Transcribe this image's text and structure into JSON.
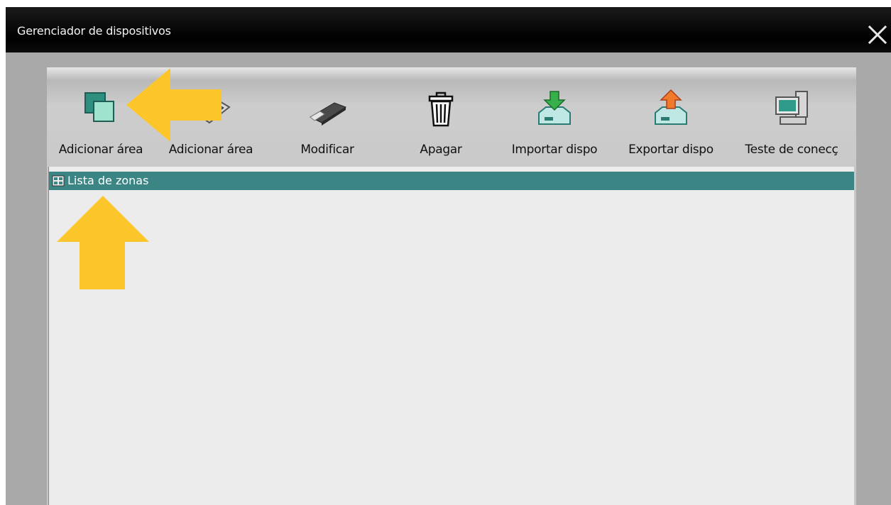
{
  "window": {
    "title": "Gerenciador de dispositivos",
    "close_icon": "close-icon"
  },
  "toolbar": {
    "items": [
      {
        "label": "Adicionar área",
        "icon": "add-area-icon"
      },
      {
        "label": "Adicionar área",
        "icon": "add-device-icon"
      },
      {
        "label": "Modificar",
        "icon": "modify-icon"
      },
      {
        "label": "Apagar",
        "icon": "trash-icon"
      },
      {
        "label": "Importar dispo",
        "icon": "import-icon"
      },
      {
        "label": "Exportar dispo",
        "icon": "export-icon"
      },
      {
        "label": "Teste de conecç",
        "icon": "connection-test-icon"
      }
    ]
  },
  "tree": {
    "root_label": "Lista de zonas",
    "root_icon": "zone-list-icon"
  },
  "annotations": {
    "color": "#fcc62a"
  }
}
